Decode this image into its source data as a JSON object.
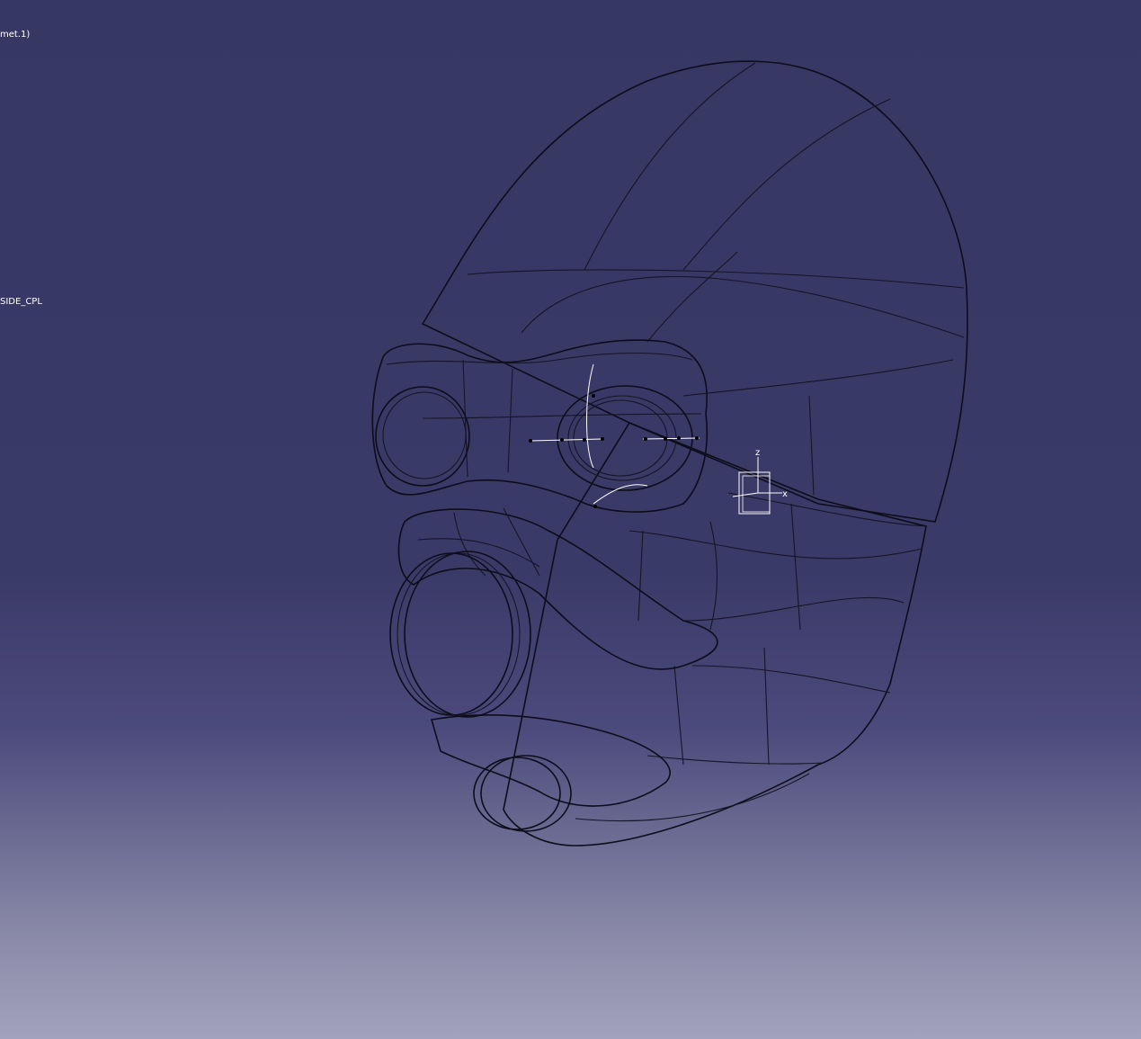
{
  "specification_tree": {
    "items": [
      {
        "label": "met.1)"
      },
      {
        "label": "SIDE_CPL"
      }
    ]
  },
  "model": {
    "part": "helmet-gas-mask",
    "shading_color": "#c8c8f0",
    "background_top": "#373764",
    "background_bottom": "#a3a2bc"
  },
  "axis_system": {
    "z_label": "z",
    "x_label": "x"
  }
}
